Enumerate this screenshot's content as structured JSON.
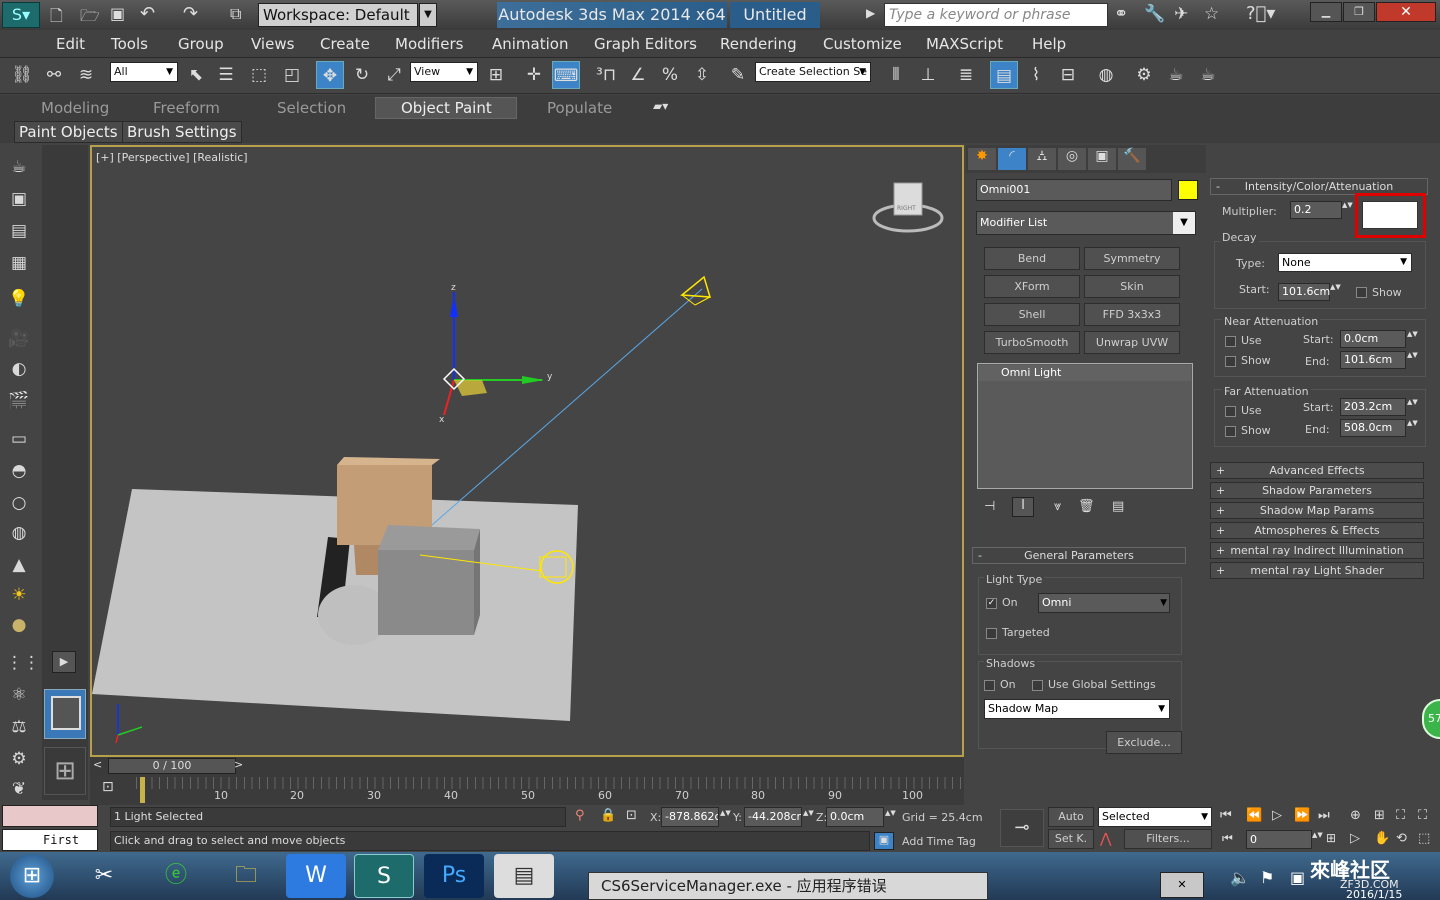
{
  "title": {
    "workspace": "Workspace: Default",
    "app": "Autodesk 3ds Max  2014 x64",
    "file": "Untitled",
    "search_placeholder": "Type a keyword or phrase"
  },
  "menu": [
    "Edit",
    "Tools",
    "Group",
    "Views",
    "Create",
    "Modifiers",
    "Animation",
    "Graph Editors",
    "Rendering",
    "Customize",
    "MAXScript",
    "Help"
  ],
  "toolbar": {
    "filter": "All",
    "refcoord": "View",
    "selection_set": "Create Selection Se"
  },
  "ribbon": {
    "tabs": [
      "Modeling",
      "Freeform",
      "Selection",
      "Object Paint",
      "Populate"
    ],
    "active_tab": "Object Paint",
    "subtabs": [
      "Paint Objects",
      "Brush Settings"
    ]
  },
  "viewport": {
    "label": "[+] [Perspective] [Realistic]",
    "axis_x": "x",
    "axis_y": "y",
    "axis_z": "z",
    "viewcube": "RIGHT"
  },
  "timeline": {
    "frame_label": "0 / 100",
    "ticks": [
      "10",
      "20",
      "30",
      "40",
      "50",
      "60",
      "70",
      "80",
      "90",
      "100"
    ]
  },
  "command_panel": {
    "object_name": "Omni001",
    "object_color": "#ffff00",
    "modifier_list": "Modifier List",
    "modifier_buttons": [
      "Bend",
      "Symmetry",
      "XForm",
      "Skin",
      "Shell",
      "FFD 3x3x3",
      "TurboSmooth",
      "Unwrap UVW"
    ],
    "stack_item": "Omni Light",
    "general": {
      "title": "General Parameters",
      "light_type_label": "Light Type",
      "on_label": "On",
      "light_type": "Omni",
      "targeted_label": "Targeted",
      "shadows_label": "Shadows",
      "shadows_on_label": "On",
      "global_label": "Use Global Settings",
      "shadow_type": "Shadow Map",
      "exclude": "Exclude..."
    }
  },
  "intensity": {
    "title": "Intensity/Color/Attenuation",
    "multiplier_label": "Multiplier:",
    "multiplier": "0.2",
    "light_color": "#ffffff",
    "highlight_color": "#e00000",
    "decay_label": "Decay",
    "type_label": "Type:",
    "type_value": "None",
    "start_label": "Start:",
    "start_value": "101.6cm",
    "show_label": "Show",
    "near_label": "Near Attenuation",
    "near_use": "Use",
    "near_show": "Show",
    "near_start_label": "Start:",
    "near_start": "0.0cm",
    "near_end_label": "End:",
    "near_end": "101.6cm",
    "far_label": "Far Attenuation",
    "far_use": "Use",
    "far_show": "Show",
    "far_start_label": "Start:",
    "far_start": "203.2cm",
    "far_end_label": "End:",
    "far_end": "508.0cm"
  },
  "rollouts": [
    "Advanced Effects",
    "Shadow Parameters",
    "Shadow Map Params",
    "Atmospheres & Effects",
    "mental ray Indirect Illumination",
    "mental ray Light Shader"
  ],
  "status": {
    "maxscript": "First",
    "selected": "1 Light Selected",
    "prompt": "Click and drag to select and move objects",
    "x_label": "X:",
    "x": "-878.862cr",
    "y_label": "Y:",
    "y": "-44.208cm",
    "z_label": "Z:",
    "z": "0.0cm",
    "grid": "Grid = 25.4cm",
    "add_time_tag": "Add Time Tag",
    "auto": "Auto",
    "setk": "Set K.",
    "key_filter": "Selected",
    "filters": "Filters...",
    "frame": "0"
  },
  "taskbar": {
    "window": "CS6ServiceManager.exe - 应用程序错误",
    "date": "2016/1/15",
    "watermark": "來峰社区",
    "watermark_sub": "ZF3D.COM",
    "badge": "57"
  }
}
